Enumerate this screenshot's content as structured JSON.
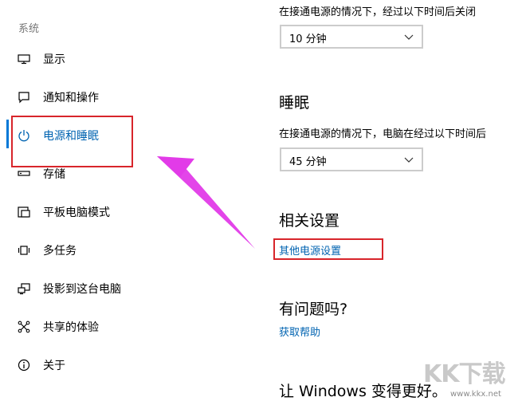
{
  "sidebar": {
    "section_title": "系统",
    "items": [
      {
        "label": "显示",
        "icon": "monitor-icon"
      },
      {
        "label": "通知和操作",
        "icon": "chat-bubble-icon"
      },
      {
        "label": "电源和睡眠",
        "icon": "power-icon",
        "selected": true
      },
      {
        "label": "存储",
        "icon": "storage-drive-icon"
      },
      {
        "label": "平板电脑模式",
        "icon": "tablet-mode-icon"
      },
      {
        "label": "多任务",
        "icon": "multitasking-icon"
      },
      {
        "label": "投影到这台电脑",
        "icon": "project-icon"
      },
      {
        "label": "共享的体验",
        "icon": "shared-experiences-icon"
      },
      {
        "label": "关于",
        "icon": "info-icon"
      }
    ]
  },
  "screen": {
    "description": "在接通电源的情况下，经过以下时间后关闭",
    "select_value": "10 分钟"
  },
  "sleep": {
    "heading": "睡眠",
    "description": "在接通电源的情况下，电脑在经过以下时间后",
    "select_value": "45 分钟"
  },
  "related": {
    "heading": "相关设置",
    "link": "其他电源设置"
  },
  "help": {
    "heading": "有问题吗?",
    "link": "获取帮助"
  },
  "improve": {
    "heading": "让 Windows 变得更好。"
  },
  "watermark": {
    "brand": "KK下载",
    "url": "www.kkx.net"
  },
  "colors": {
    "accent": "#0078d7",
    "link": "#0063b1",
    "annotation_box": "#d8252b",
    "annotation_arrow": "#e23be8"
  }
}
